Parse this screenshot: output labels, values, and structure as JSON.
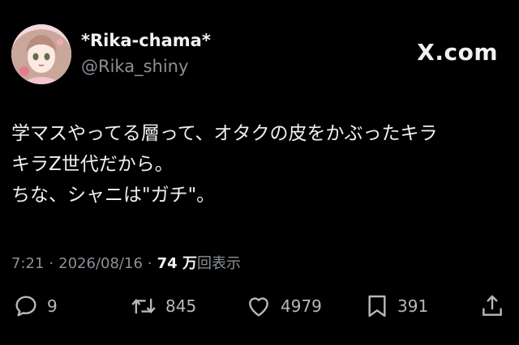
{
  "header": {
    "display_name": "*Rika-chama*",
    "handle": "@Rika_shiny",
    "brand": "X.com"
  },
  "tweet": {
    "lines": [
      "学マスやってる層って、オタクの皮をかぶったキラ",
      "キラZ世代だから。",
      "ちな、シャニは\"ガチ\"。"
    ]
  },
  "meta": {
    "time": "7:21",
    "date": "2026/08/16",
    "views_number": "74 万",
    "views_suffix": "回表示",
    "separator": "·"
  },
  "actions": {
    "reply": {
      "icon": "reply-icon",
      "count": "9"
    },
    "repost": {
      "icon": "repost-icon",
      "count": "845"
    },
    "like": {
      "icon": "heart-icon",
      "count": "4979"
    },
    "bookmark": {
      "icon": "bookmark-icon",
      "count": "391"
    },
    "share": {
      "icon": "share-icon"
    }
  },
  "colors": {
    "background": "#000000",
    "text": "#f0f0f0",
    "muted": "#8b9096"
  }
}
